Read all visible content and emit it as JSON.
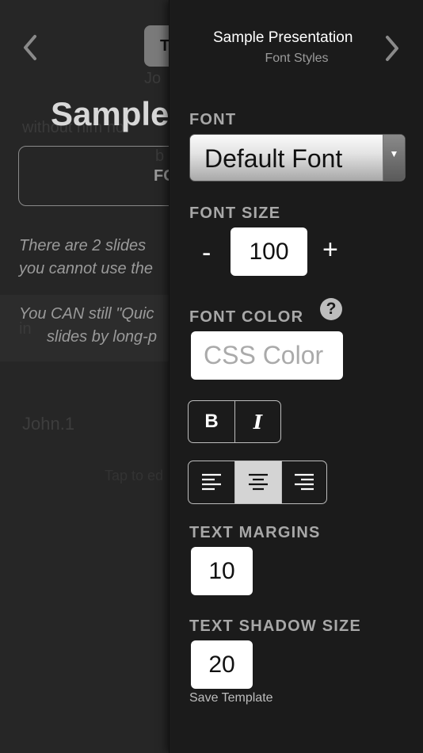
{
  "background": {
    "tab_label": "T",
    "ghost_line_1": "Jo",
    "ghost_line_2": "without him ho",
    "ghost_line_3": "b",
    "title": "Sample",
    "box_button_label": "FC",
    "info_line_1": "There are 2 slides",
    "info_line_2": "you cannot use the",
    "notice_line_1": "You CAN still \"Quic",
    "notice_line_2": "slides by long-p",
    "ghost_left": "in",
    "faded_name": "John.1",
    "faded_hint": "Tap to ed"
  },
  "panel": {
    "title": "Sample Presentation",
    "subtitle": "Font Styles"
  },
  "font": {
    "label": "FONT",
    "selected": "Default Font",
    "arrow": "▼"
  },
  "font_size": {
    "label": "FONT SIZE",
    "decrement": "-",
    "value": "100",
    "increment": "+"
  },
  "font_color": {
    "label": "FONT COLOR",
    "help": "?",
    "placeholder": "CSS Color"
  },
  "style_toggles": {
    "bold": "B",
    "italic": "I"
  },
  "alignment": {
    "options": [
      "left",
      "center",
      "right"
    ],
    "selected": "center"
  },
  "text_margins": {
    "label": "TEXT MARGINS",
    "value": "10"
  },
  "text_shadow": {
    "label": "TEXT SHADOW SIZE",
    "value": "20"
  },
  "cut_off_text": "Save Template",
  "colors": {
    "panel_bg": "#1b1b1b",
    "label": "#a8a8a8",
    "segment_border": "#bdbdbd",
    "segment_active": "#d4d4d4"
  }
}
